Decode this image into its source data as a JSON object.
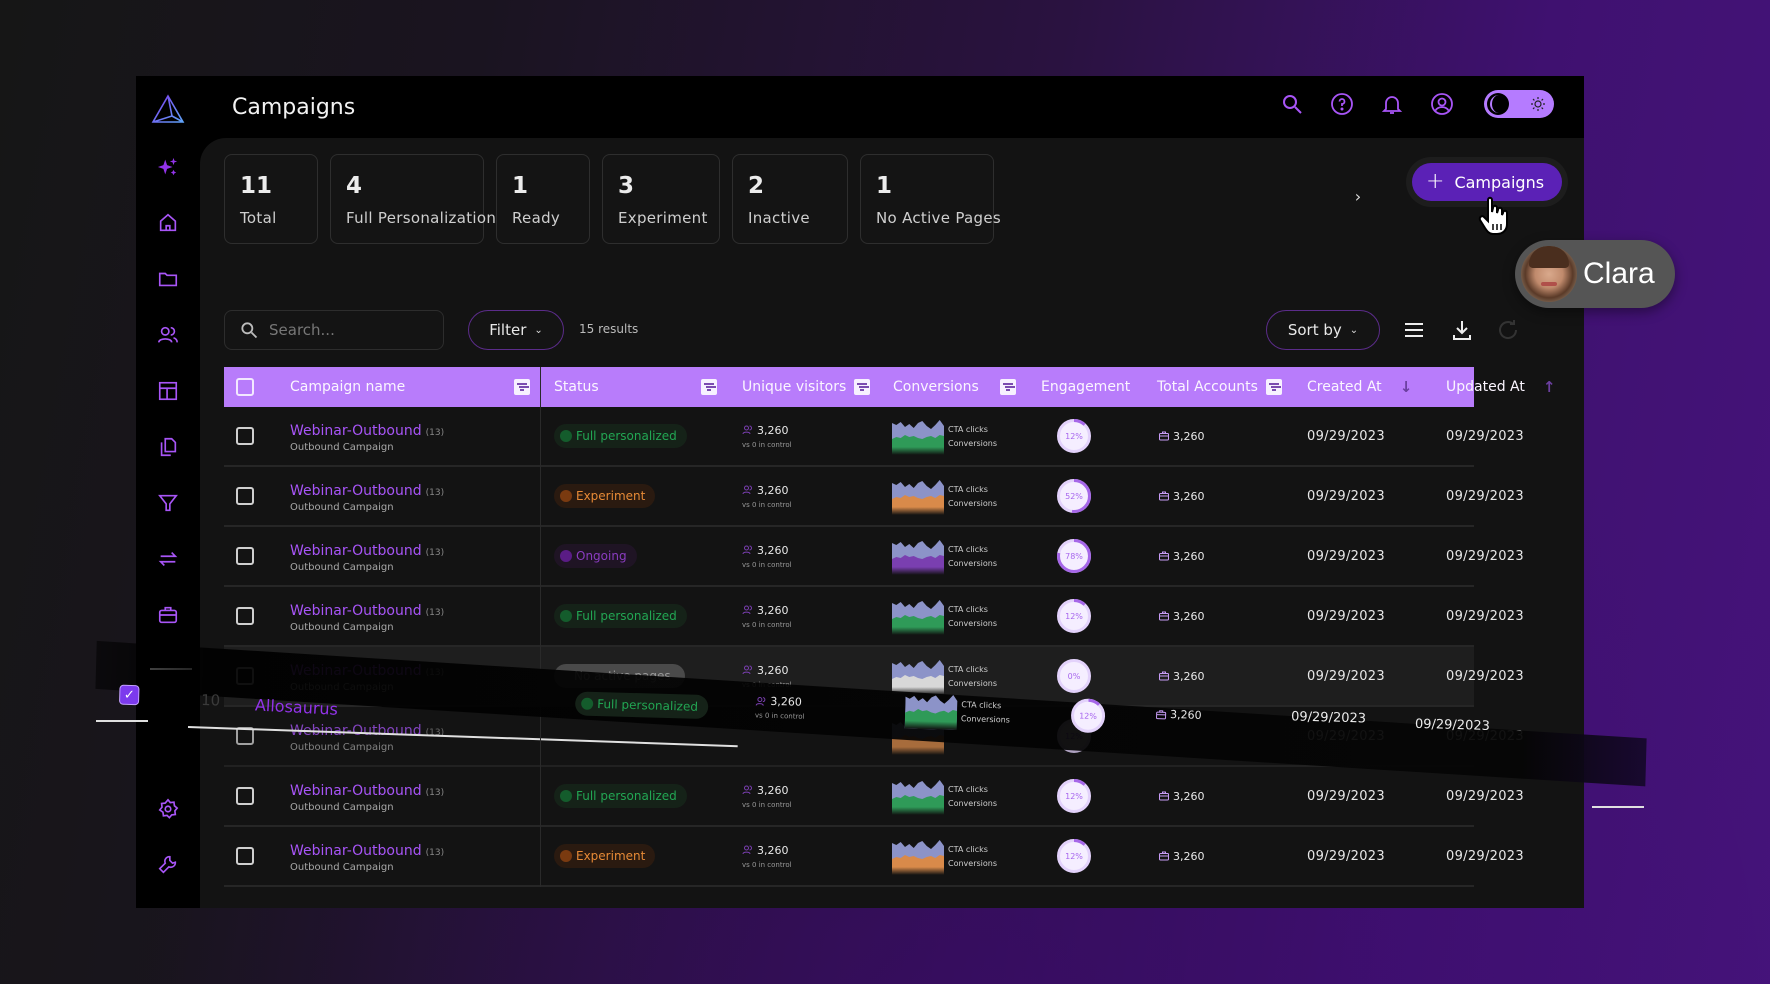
{
  "header": {
    "title": "Campaigns",
    "icons": [
      "search-icon",
      "help-icon",
      "bell-icon",
      "user-circle-icon"
    ],
    "theme_toggle": "dark"
  },
  "sidebar": {
    "top_items": [
      "sparkles",
      "home",
      "folder",
      "users",
      "layout",
      "copy-pages",
      "funnel",
      "swap-arrows",
      "briefcase"
    ],
    "bottom_items": [
      "settings",
      "wrench"
    ]
  },
  "stats": [
    {
      "value": "11",
      "label": "Total"
    },
    {
      "value": "4",
      "label": "Full Personalization"
    },
    {
      "value": "1",
      "label": "Ready"
    },
    {
      "value": "3",
      "label": "Experiment"
    },
    {
      "value": "2",
      "label": "Inactive"
    },
    {
      "value": "1",
      "label": "No Active Pages"
    }
  ],
  "stats_next": "›",
  "add_button": {
    "icon": "+",
    "label": "Campaigns"
  },
  "toolbar": {
    "search_placeholder": "Search...",
    "filter_label": "Filter",
    "results": "15 results",
    "sort_label": "Sort by"
  },
  "table": {
    "columns": [
      "Campaign name",
      "Status",
      "Unique visitors",
      "Conversions",
      "Engagement",
      "Total Accounts",
      "Created At",
      "Updated At"
    ],
    "rows": [
      {
        "name": "Webinar-Outbound",
        "count": "(13)",
        "sub": "Outbound Campaign",
        "status": "Full personalized",
        "status_type": "full",
        "visitors": "3,260",
        "visitors_sub": "vs 0 in control",
        "conv_labels": [
          "CTA clicks",
          "Conversions"
        ],
        "engagement": 12,
        "accounts": "3,260",
        "created": "09/29/2023",
        "updated": "09/29/2023"
      },
      {
        "name": "Webinar-Outbound",
        "count": "(13)",
        "sub": "Outbound Campaign",
        "status": "Experiment",
        "status_type": "exp",
        "visitors": "3,260",
        "visitors_sub": "vs 0 in control",
        "conv_labels": [
          "CTA clicks",
          "Conversions"
        ],
        "engagement": 52,
        "accounts": "3,260",
        "created": "09/29/2023",
        "updated": "09/29/2023"
      },
      {
        "name": "Webinar-Outbound",
        "count": "(13)",
        "sub": "Outbound Campaign",
        "status": "Ongoing",
        "status_type": "ongo",
        "visitors": "3,260",
        "visitors_sub": "vs 0 in control",
        "conv_labels": [
          "CTA clicks",
          "Conversions"
        ],
        "engagement": 78,
        "accounts": "3,260",
        "created": "09/29/2023",
        "updated": "09/29/2023"
      },
      {
        "name": "Webinar-Outbound",
        "count": "(13)",
        "sub": "Outbound Campaign",
        "status": "Full personalized",
        "status_type": "full",
        "visitors": "3,260",
        "visitors_sub": "vs 0 in control",
        "conv_labels": [
          "CTA clicks",
          "Conversions"
        ],
        "engagement": 12,
        "accounts": "3,260",
        "created": "09/29/2023",
        "updated": "09/29/2023"
      },
      {
        "name": "Webinar-Outbound",
        "count": "(13)",
        "sub": "Outbound Campaign",
        "status": "No active pages",
        "status_type": "none",
        "visitors": "3,260",
        "visitors_sub": "vs 0 in control",
        "conv_labels": [
          "CTA clicks",
          "Conversions"
        ],
        "engagement": 0,
        "accounts": "3,260",
        "created": "09/29/2023",
        "updated": "09/29/2023",
        "highlight": true
      },
      {
        "name": "Webinar-Outbound",
        "count": "(13)",
        "sub": "Outbound Campaign",
        "status": "",
        "status_type": "exp",
        "visitors": "",
        "visitors_sub": "",
        "conv_labels": [
          "",
          ""
        ],
        "engagement": 12,
        "accounts": "",
        "created": "09/29/2023",
        "updated": "09/29/2023",
        "obscured": true
      },
      {
        "name": "Webinar-Outbound",
        "count": "(13)",
        "sub": "Outbound Campaign",
        "status": "Full personalized",
        "status_type": "full",
        "visitors": "3,260",
        "visitors_sub": "vs 0 in control",
        "conv_labels": [
          "CTA clicks",
          "Conversions"
        ],
        "engagement": 12,
        "accounts": "3,260",
        "created": "09/29/2023",
        "updated": "09/29/2023"
      },
      {
        "name": "Webinar-Outbound",
        "count": "(13)",
        "sub": "Outbound Campaign",
        "status": "Experiment",
        "status_type": "exp",
        "visitors": "3,260",
        "visitors_sub": "vs 0 in control",
        "conv_labels": [
          "CTA clicks",
          "Conversions"
        ],
        "engagement": 12,
        "accounts": "3,260",
        "created": "09/29/2023",
        "updated": "09/29/2023"
      }
    ]
  },
  "dragged_row": {
    "checked": true,
    "index": "10",
    "name": "Allosaurus",
    "status": "Full personalized",
    "visitors": "3,260",
    "visitors_sub": "vs 0 in control",
    "conv_labels": [
      "CTA clicks",
      "Conversions"
    ],
    "engagement": 12,
    "accounts": "3,260",
    "created": "09/29/2023",
    "updated": "09/29/2023"
  },
  "collaborator": {
    "name": "Clara"
  },
  "colors": {
    "accent": "#a855f7",
    "header_bg": "#b87cfb",
    "button_bg": "#5b21b6",
    "full": "#22a653",
    "experiment": "#e78a36",
    "ongoing": "#8a3cc0",
    "chart_top": "#8c93c8",
    "chart_full": "#2f9a58",
    "chart_exp": "#d98a4a",
    "chart_ongo": "#7a3fb0",
    "chart_none": "#d8d8d8"
  }
}
